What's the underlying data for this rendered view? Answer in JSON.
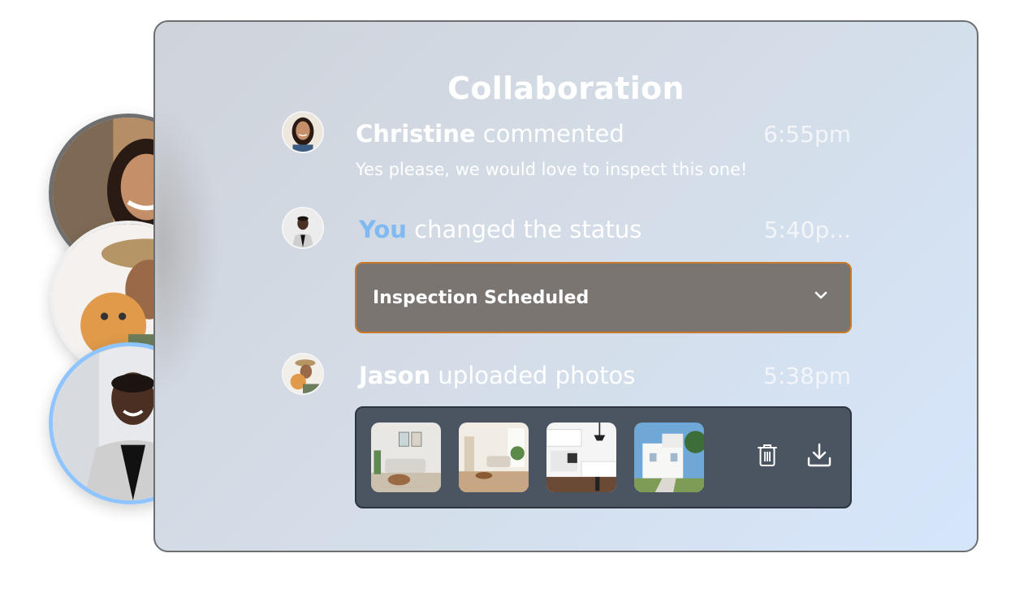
{
  "panel": {
    "title": "Collaboration"
  },
  "activity": [
    {
      "name": "Christine",
      "action": "commented",
      "time": "6:55pm",
      "comment": "Yes please, we would love to inspect this one!"
    },
    {
      "name": "You",
      "action": "changed the status",
      "time": "5:40p...",
      "status": "Inspection Scheduled"
    },
    {
      "name": "Jason",
      "action": "uploaded photos",
      "time": "5:38pm",
      "photos": [
        "living-room-photo",
        "lounge-photo",
        "kitchen-photo",
        "house-exterior-photo"
      ]
    }
  ],
  "colors": {
    "you_accent": "#7fbaf3",
    "status_border": "#c97a2b",
    "status_bg": "#7a7570",
    "photos_bg": "#4b5562",
    "selected_avatar_ring": "#8ec4ff"
  },
  "icons": {
    "status_dropdown": "chevron-down-icon",
    "delete": "trash-icon",
    "download": "download-icon"
  }
}
